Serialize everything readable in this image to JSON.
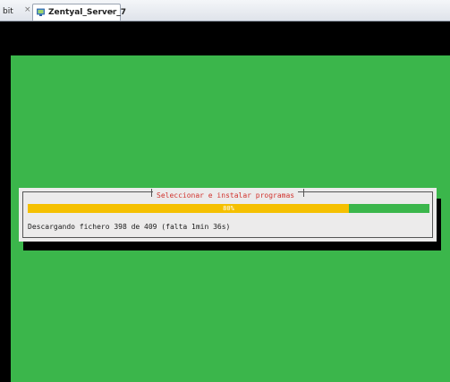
{
  "tabs": [
    {
      "label": "bit",
      "close_glyph": "×",
      "active": false
    },
    {
      "label": "Zentyal_Server_7",
      "close_glyph": "×",
      "active": true,
      "icon": "virtual-machine-icon"
    }
  ],
  "installer": {
    "dialog_title": "Seleccionar e instalar programas",
    "progress_percent": 80,
    "progress_label": "80%",
    "status": "Descargando fichero 398 de 409 (falta 1min 36s)"
  },
  "colors": {
    "background_green": "#3bb64b",
    "progress_fill": "#f5c000",
    "dialog_bg": "#ecebeb",
    "title_red": "#d1332e"
  }
}
